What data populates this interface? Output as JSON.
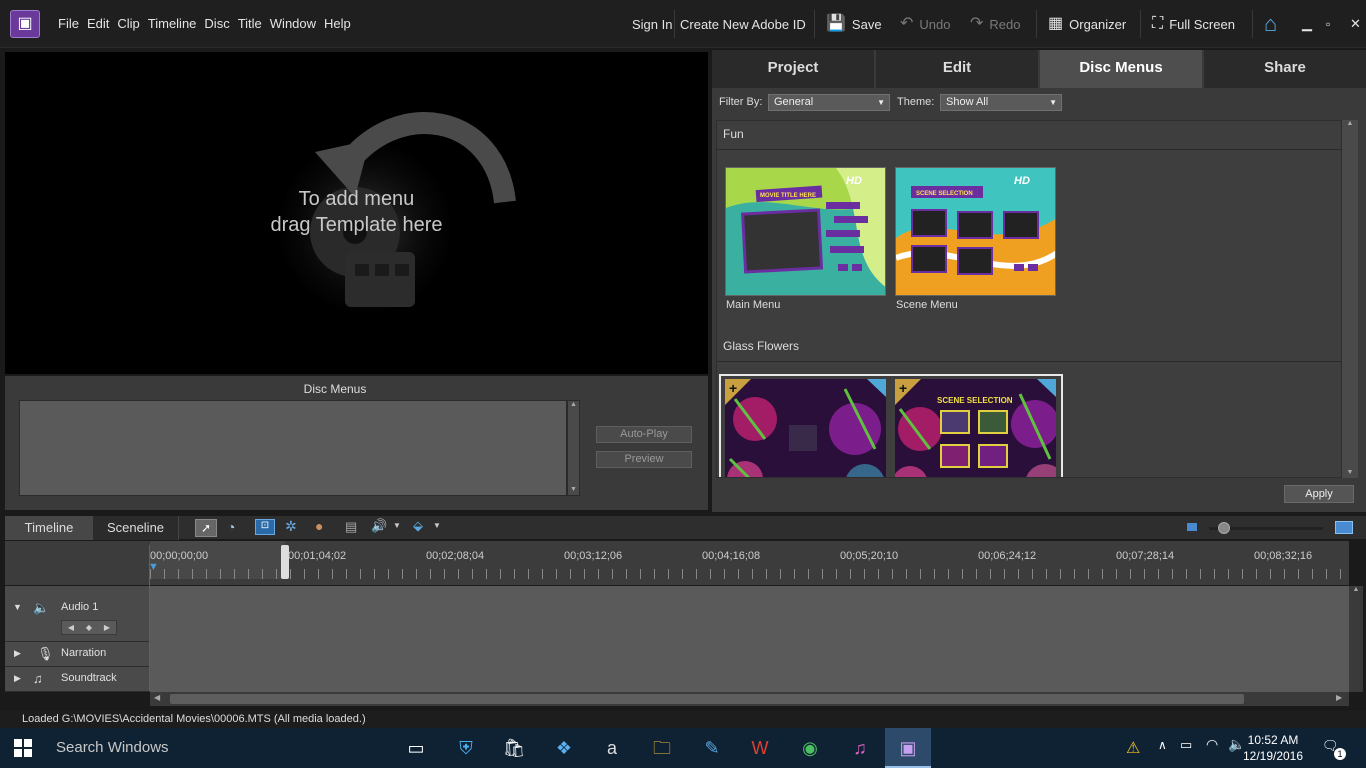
{
  "menu": [
    "File",
    "Edit",
    "Clip",
    "Timeline",
    "Disc",
    "Title",
    "Window",
    "Help"
  ],
  "toolbar": {
    "sign_in": "Sign In",
    "create_id": "Create New Adobe ID",
    "save": "Save",
    "undo": "Undo",
    "redo": "Redo",
    "organizer": "Organizer",
    "full_screen": "Full Screen"
  },
  "monitor": {
    "drop_line1": "To add menu",
    "drop_line2": "drag Template here"
  },
  "disc_panel": {
    "title": "Disc Menus",
    "autoplay": "Auto-Play",
    "preview": "Preview"
  },
  "tabs": [
    "Project",
    "Edit",
    "Disc Menus",
    "Share"
  ],
  "active_tab": "Disc Menus",
  "filter": {
    "filter_label": "Filter By:",
    "filter_value": "General",
    "theme_label": "Theme:",
    "theme_value": "Show All"
  },
  "categories": [
    {
      "name": "Fun",
      "items": [
        {
          "caption": "Main Menu",
          "title_text": "MOVIE TITLE HERE",
          "badge": "HD"
        },
        {
          "caption": "Scene Menu",
          "title_text": "SCENE SELECTION",
          "badge": "HD"
        }
      ]
    },
    {
      "name": "Glass Flowers",
      "items": [
        {
          "caption": "",
          "title_text": ""
        },
        {
          "caption": "",
          "title_text": "SCENE SELECTION"
        }
      ]
    }
  ],
  "apply": "Apply",
  "timeline": {
    "tabs": [
      "Timeline",
      "Sceneline"
    ],
    "ticks": [
      "00;00;00;00",
      "00;01;04;02",
      "00;02;08;04",
      "00;03;12;06",
      "00;04;16;08",
      "00;05;20;10",
      "00;06;24;12",
      "00;07;28;14",
      "00;08;32;16"
    ],
    "tracks": [
      "Audio 1",
      "Narration",
      "Soundtrack"
    ]
  },
  "status": "Loaded G:\\MOVIES\\Accidental Movies\\00006.MTS (All media loaded.)",
  "taskbar": {
    "search": "Search Windows",
    "time": "10:52 AM",
    "date": "12/19/2016",
    "notifications": "1"
  },
  "colors": {
    "accent": "#6a3a9a",
    "playhead": "#d03030",
    "taskbar": "#0f2234"
  }
}
